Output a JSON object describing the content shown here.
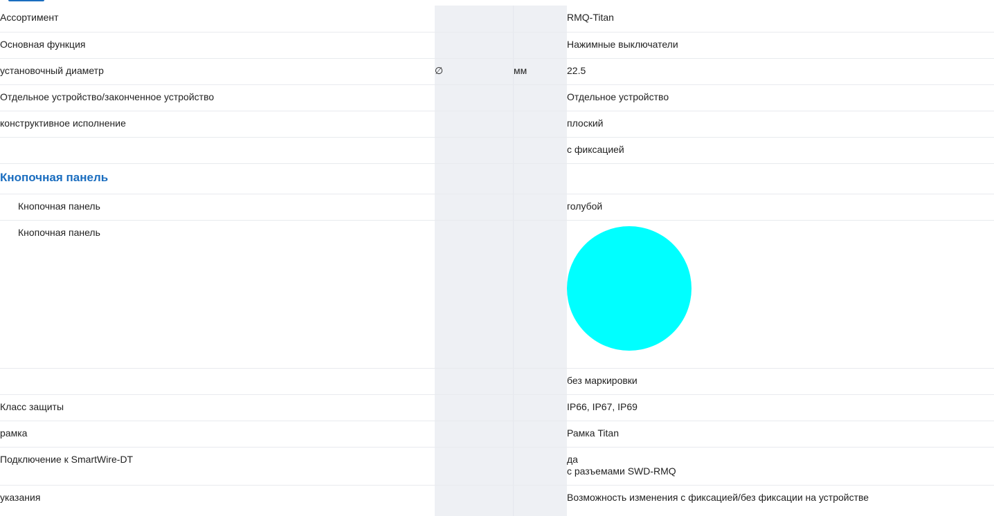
{
  "rows": [
    {
      "label": "Ассортимент",
      "value": "RMQ-Titan"
    },
    {
      "label": "Основная функция",
      "value": "Нажимные выключатели"
    },
    {
      "label": "установочный диаметр",
      "symbol": "∅",
      "unit": "мм",
      "value": "22.5"
    },
    {
      "label": "Отдельное устройство/законченное устройство",
      "value": "Отдельное устройство"
    },
    {
      "label": "конструктивное исполнение",
      "value": "плоский"
    },
    {
      "label": "",
      "value": "с фиксацией"
    },
    {
      "section_title": "Кнопочная панель"
    },
    {
      "label": "Кнопочная панель",
      "value": "голубой"
    },
    {
      "label": "Кнопочная панель",
      "swatch_color": "#00ffff"
    },
    {
      "label": "",
      "value": "без маркировки"
    },
    {
      "label": "Класс защиты",
      "value": "IP66, IP67, IP69"
    },
    {
      "label": "рамка",
      "value": "Рамка Titan"
    },
    {
      "label": "Подключение к SmartWire-DT",
      "value_line1": "да",
      "value_line2": "с разъемами SWD-RMQ"
    },
    {
      "label": "указания",
      "value": "Возможность изменения с фиксацией/без фиксации на устройстве"
    }
  ]
}
